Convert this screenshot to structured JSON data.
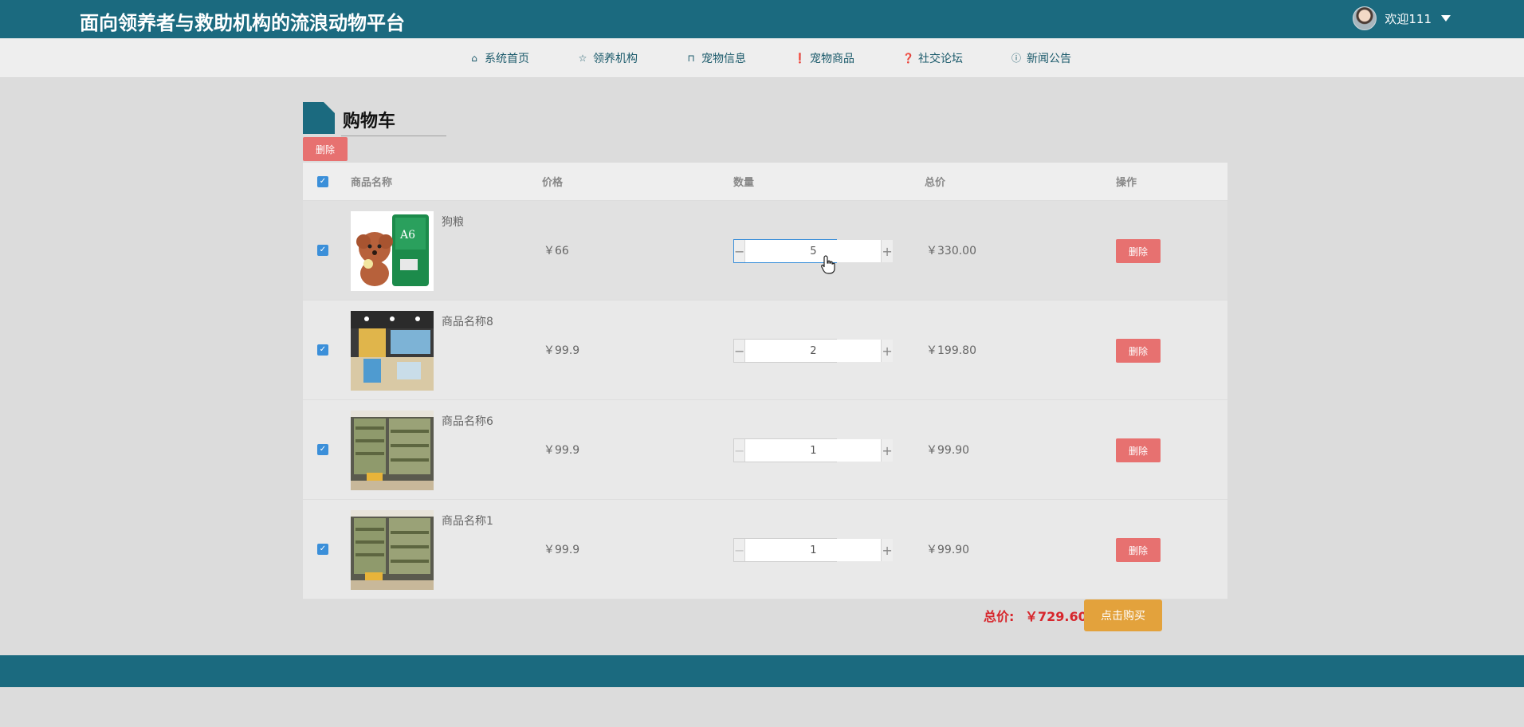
{
  "header": {
    "site_title": "面向领养者与救助机构的流浪动物平台",
    "welcome": "欢迎111"
  },
  "nav": {
    "items": [
      {
        "label": "系统首页",
        "icon": "home-icon"
      },
      {
        "label": "领养机构",
        "icon": "star-icon"
      },
      {
        "label": "宠物信息",
        "icon": "bag-icon"
      },
      {
        "label": "宠物商品",
        "icon": "info-circle-icon"
      },
      {
        "label": "社交论坛",
        "icon": "question-circle-icon"
      },
      {
        "label": "新闻公告",
        "icon": "info-circle-icon"
      }
    ]
  },
  "page": {
    "title": "购物车",
    "delete_label": "删除"
  },
  "table": {
    "headers": {
      "name": "商品名称",
      "price": "价格",
      "qty": "数量",
      "total": "总价",
      "op": "操作"
    },
    "rows": [
      {
        "name": "狗粮",
        "price": "￥66",
        "qty": "5",
        "total": "￥330.00",
        "delete": "删除"
      },
      {
        "name": "商品名称8",
        "price": "￥99.9",
        "qty": "2",
        "total": "￥199.80",
        "delete": "删除"
      },
      {
        "name": "商品名称6",
        "price": "￥99.9",
        "qty": "1",
        "total": "￥99.90",
        "delete": "删除"
      },
      {
        "name": "商品名称1",
        "price": "￥99.9",
        "qty": "1",
        "total": "￥99.90",
        "delete": "删除"
      }
    ]
  },
  "summary": {
    "label": "总价:",
    "value": "￥729.60",
    "buy_label": "点击购买"
  },
  "colors": {
    "brand": "#1b6a7f",
    "danger": "#e77170",
    "buy": "#e3a23c",
    "price_red": "#d7262c"
  }
}
